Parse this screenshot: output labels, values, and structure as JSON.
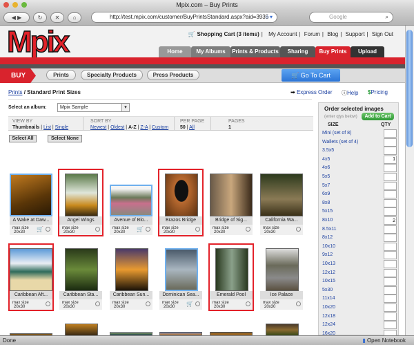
{
  "window": {
    "title": "Mpix.com – Buy Prints"
  },
  "browser": {
    "url": "http://test.mpix.com/customer/BuyPrintsStandard.aspx?aid=3935",
    "search_placeholder": "Google",
    "status": "Done",
    "notebook": "Open Notebook"
  },
  "header": {
    "logo": "Mpix",
    "links": [
      "Shopping Cart (3 items)",
      "My Account",
      "Forum",
      "Blog",
      "Support",
      "Sign Out"
    ],
    "tabs": [
      "Home",
      "My Albums",
      "Prints & Products",
      "Sharing",
      "Buy Prints",
      "Upload"
    ],
    "active_tab": "Buy Prints"
  },
  "subnav": {
    "buy": "BUY",
    "items": [
      "Prints",
      "Specialty Products",
      "Press Products"
    ],
    "go_to_cart": "Go To Cart"
  },
  "breadcrumb": {
    "link": "Prints",
    "sep": "/",
    "current": "Standard Print Sizes"
  },
  "actions": {
    "express": "Express Order",
    "help": "Help",
    "pricing": "Pricing"
  },
  "album": {
    "label": "Select an album:",
    "value": "Mpix Sample"
  },
  "filters": {
    "view_by": "VIEW BY",
    "view": [
      "Thumbnails",
      "List",
      "Single"
    ],
    "sort_by": "SORT BY",
    "sort": [
      "Newest",
      "Oldest",
      "A-Z",
      "Z-A",
      "Custom"
    ],
    "per_page": "PER PAGE",
    "per": [
      "50",
      "All"
    ],
    "pages": "PAGES",
    "page_count": "1"
  },
  "select_all": "Select All",
  "select_none": "Select None",
  "photos": [
    {
      "name": "A Wake at Daw...",
      "max": "max size",
      "size": "20x30",
      "in_cart": true,
      "selected": false
    },
    {
      "name": "Angel Wings",
      "max": "max size",
      "size": "20x30",
      "in_cart": false,
      "selected": true
    },
    {
      "name": "Avenue of Blo...",
      "max": "max size",
      "size": "20x30",
      "in_cart": true,
      "selected": false
    },
    {
      "name": "Brazos Bridge",
      "max": "max size",
      "size": "20x30",
      "in_cart": false,
      "selected": true
    },
    {
      "name": "Bridge of Sig...",
      "max": "max size",
      "size": "20x30",
      "in_cart": false,
      "selected": false
    },
    {
      "name": "California Wa...",
      "max": "max size",
      "size": "20x30",
      "in_cart": false,
      "selected": false
    },
    {
      "name": "Caribbean Aft...",
      "max": "max size",
      "size": "20x30",
      "in_cart": false,
      "selected": true
    },
    {
      "name": "Caribbean Sta...",
      "max": "max size",
      "size": "20x30",
      "in_cart": false,
      "selected": false
    },
    {
      "name": "Caribbean Sun...",
      "max": "max size",
      "size": "20x30",
      "in_cart": false,
      "selected": false
    },
    {
      "name": "Dominican Sea...",
      "max": "max size",
      "size": "20x30",
      "in_cart": true,
      "selected": false
    },
    {
      "name": "Emerald Pool",
      "max": "max size",
      "size": "20x30",
      "in_cart": false,
      "selected": true
    },
    {
      "name": "Ice Palace",
      "max": "max size",
      "size": "20x30",
      "in_cart": false,
      "selected": false
    }
  ],
  "order": {
    "title": "Order selected images",
    "hint": "(enter qtys below)",
    "add": "Add to Cart",
    "size_h": "SIZE",
    "qty_h": "QTY",
    "sizes": [
      {
        "s": "Mini (set of 8)",
        "q": ""
      },
      {
        "s": "Wallets (set of 4)",
        "q": ""
      },
      {
        "s": "3.5x5",
        "q": ""
      },
      {
        "s": "4x5",
        "q": "1"
      },
      {
        "s": "4x6",
        "q": ""
      },
      {
        "s": "5x5",
        "q": ""
      },
      {
        "s": "5x7",
        "q": ""
      },
      {
        "s": "6x9",
        "q": ""
      },
      {
        "s": "8x8",
        "q": ""
      },
      {
        "s": "5x15",
        "q": ""
      },
      {
        "s": "8x10",
        "q": "2"
      },
      {
        "s": "8.5x11",
        "q": ""
      },
      {
        "s": "8x12",
        "q": ""
      },
      {
        "s": "10x10",
        "q": ""
      },
      {
        "s": "9x12",
        "q": ""
      },
      {
        "s": "10x13",
        "q": ""
      },
      {
        "s": "12x12",
        "q": ""
      },
      {
        "s": "10x15",
        "q": ""
      },
      {
        "s": "5x30",
        "q": ""
      },
      {
        "s": "11x14",
        "q": ""
      },
      {
        "s": "10x20",
        "q": ""
      },
      {
        "s": "12x18",
        "q": ""
      },
      {
        "s": "12x24",
        "q": ""
      },
      {
        "s": "16x20",
        "q": ""
      }
    ]
  }
}
